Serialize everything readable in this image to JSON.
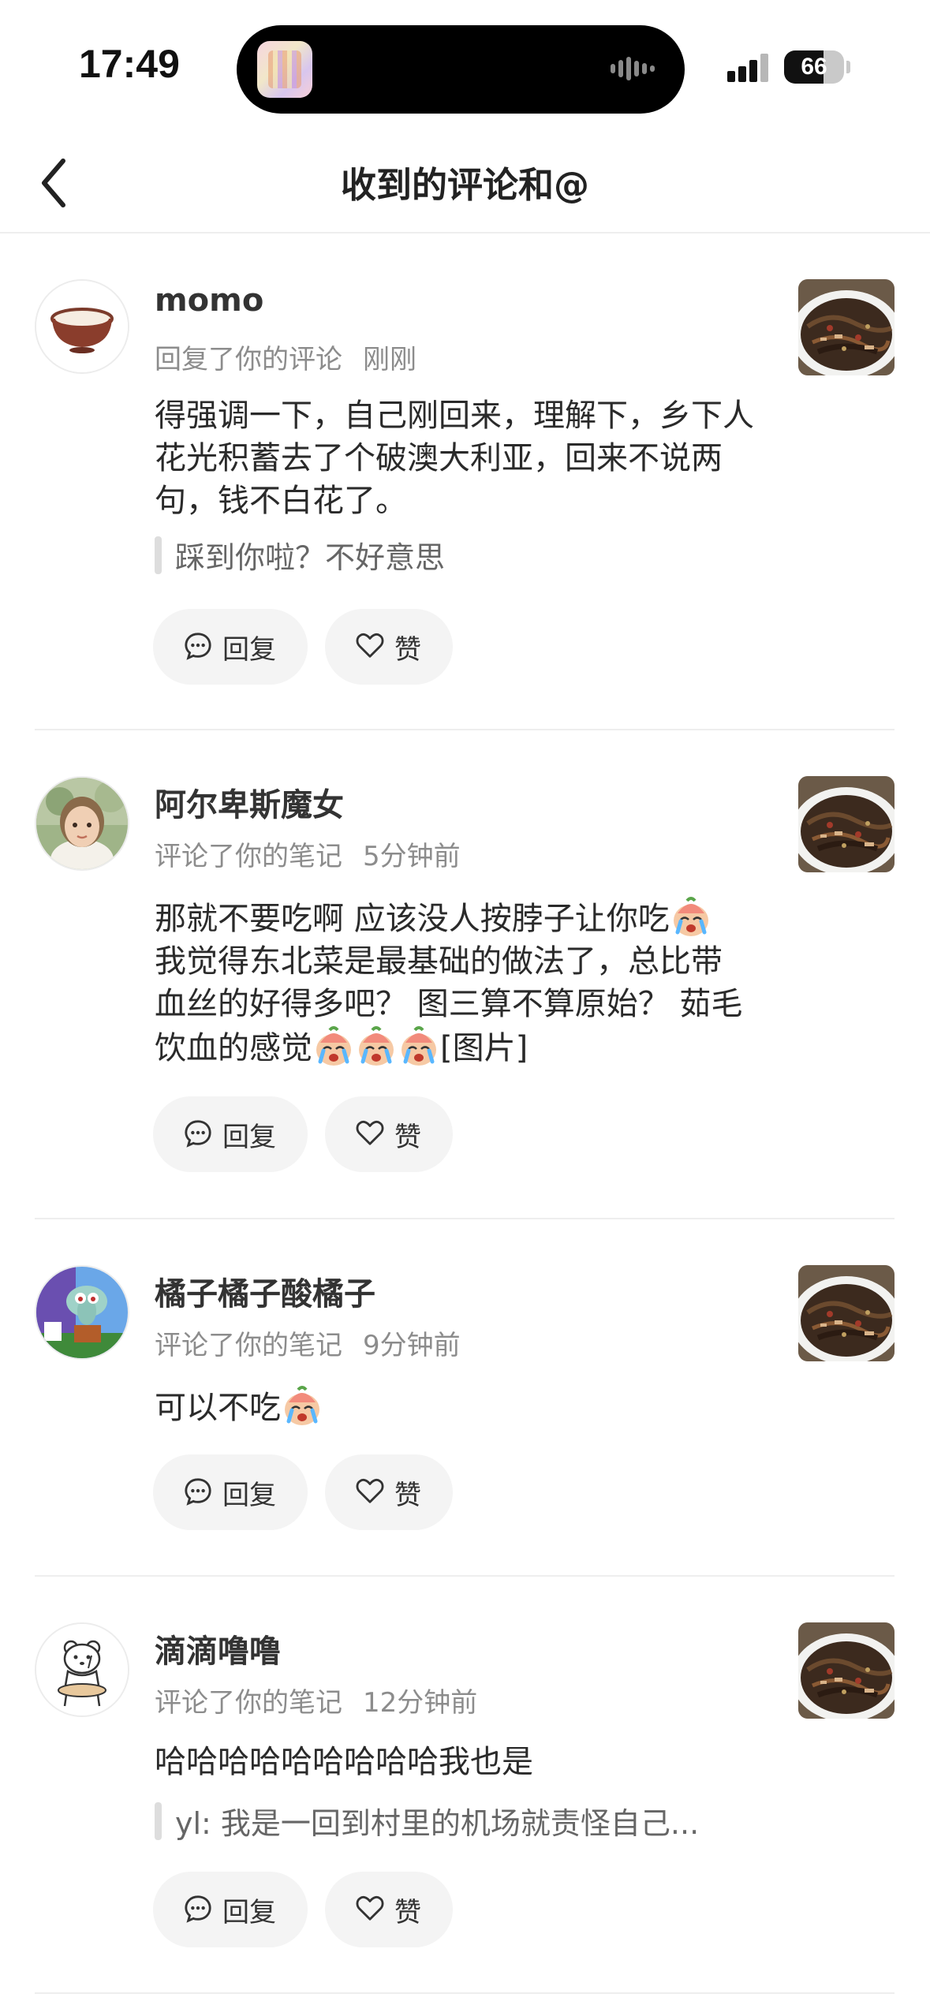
{
  "status_bar": {
    "time": "17:49",
    "battery_percent": "66",
    "battery_level": 0.66
  },
  "header": {
    "title": "收到的评论和@",
    "back_icon": "chevron-left-icon"
  },
  "actions": {
    "reply_label": "回复",
    "like_label": "赞",
    "reply_icon": "speech-bubble-icon",
    "like_icon": "heart-icon"
  },
  "comments": [
    {
      "name": "momo",
      "action": "回复了你的评论",
      "time": "刚刚",
      "content": "得强调一下，自己刚回来，理解下，乡下人花光积蓄去了个破澳大利亚，回来不说两句，钱不白花了。",
      "quote": "踩到你啦？不好意思",
      "avatar": "bowl-avatar"
    },
    {
      "name": "阿尔卑斯魔女",
      "action": "评论了你的笔记",
      "time": "5分钟前",
      "content_line1": "那就不要吃啊 应该没人按脖子让你吃",
      "content_line2": "我觉得东北菜是最基础的做法了，总比带",
      "content_line3": "血丝的好得多吧？ 图三算不算原始？ 茹毛",
      "content_line4": "饮血的感觉",
      "content_tail": "[图片]",
      "avatar": "child-photo-avatar"
    },
    {
      "name": "橘子橘子酸橘子",
      "action": "评论了你的笔记",
      "time": "9分钟前",
      "content": "可以不吃",
      "avatar": "cartoon-avatar"
    },
    {
      "name": "滴滴噜噜",
      "action": "评论了你的笔记",
      "time": "12分钟前",
      "content": "哈哈哈哈哈哈哈哈哈我也是",
      "quote": "yl: 我是一回到村里的机场就责怪自己...",
      "avatar": "bear-sketch-avatar"
    }
  ]
}
